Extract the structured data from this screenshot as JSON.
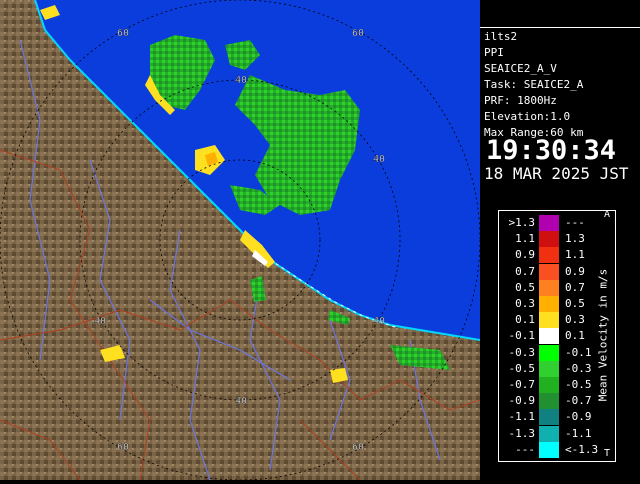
{
  "product": {
    "radar": "ilts2",
    "scan_type": "PPI",
    "task_short": "SEAICE2_A_V",
    "task": "Task: SEAICE2_A",
    "prf": "PRF: 1800Hz",
    "elevation": "Elevation:1.0",
    "max_range": "Max Range:60 km",
    "time": "19:30:34",
    "date": "18 MAR 2025 JST"
  },
  "range_labels": [
    "60",
    "60",
    "60",
    "40",
    "40",
    "40",
    "40",
    "40",
    "60"
  ],
  "legend": {
    "title": "Mean Velocity in m/s",
    "top_mark": "A",
    "bottom_mark": "T",
    "rows": [
      {
        "lo": ">1.3",
        "hi": "---",
        "color": "#b000b0"
      },
      {
        "lo": "1.1",
        "hi": "1.3",
        "color": "#d01010"
      },
      {
        "lo": "0.9",
        "hi": "1.1",
        "color": "#f03010"
      },
      {
        "lo": "0.7",
        "hi": "0.9",
        "color": "#f85020"
      },
      {
        "lo": "0.5",
        "hi": "0.7",
        "color": "#ff8020"
      },
      {
        "lo": "0.3",
        "hi": "0.5",
        "color": "#ffb000"
      },
      {
        "lo": "0.1",
        "hi": "0.3",
        "color": "#ffe020"
      },
      {
        "lo": "-0.1",
        "hi": "0.1",
        "color": "#ffffff"
      },
      {
        "lo": "-0.3",
        "hi": "-0.1",
        "color": "#00ff00"
      },
      {
        "lo": "-0.5",
        "hi": "-0.3",
        "color": "#30d030"
      },
      {
        "lo": "-0.7",
        "hi": "-0.5",
        "color": "#20b020"
      },
      {
        "lo": "-0.9",
        "hi": "-0.7",
        "color": "#209030"
      },
      {
        "lo": "-1.1",
        "hi": "-0.9",
        "color": "#108080"
      },
      {
        "lo": "-1.3",
        "hi": "-1.1",
        "color": "#10b0b0"
      },
      {
        "lo": "---",
        "hi": "<-1.3",
        "color": "#00ffff"
      }
    ]
  },
  "colors": {
    "sea": "#0a3ddc",
    "land": "#7a6446",
    "coast": "#00d8ff",
    "rivers": "#6a76e0",
    "borders": "#b04020",
    "rings": "#000000"
  }
}
